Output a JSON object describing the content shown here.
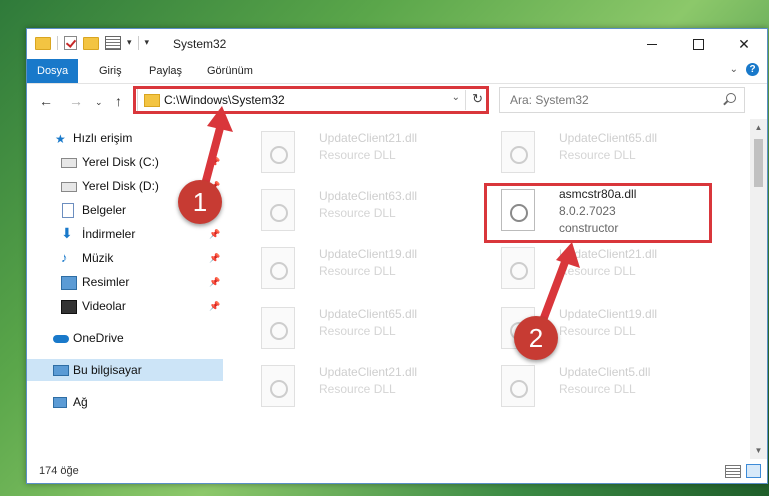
{
  "window": {
    "title": "System32"
  },
  "ribbon": {
    "tabs": [
      "Dosya",
      "Giriş",
      "Paylaş",
      "Görünüm"
    ],
    "active_tab": "Dosya"
  },
  "nav": {
    "address": "C:\\Windows\\System32",
    "search_placeholder": "Ara: System32"
  },
  "sidebar": {
    "items": [
      {
        "label": "Hızlı erişim",
        "icon": "star-icon",
        "pinned": false
      },
      {
        "label": "Yerel Disk (C:)",
        "icon": "drive-icon",
        "pinned": true
      },
      {
        "label": "Yerel Disk (D:)",
        "icon": "drive-icon",
        "pinned": true
      },
      {
        "label": "Belgeler",
        "icon": "documents-icon",
        "pinned": true
      },
      {
        "label": "İndirmeler",
        "icon": "download-icon",
        "pinned": true
      },
      {
        "label": "Müzik",
        "icon": "music-icon",
        "pinned": true
      },
      {
        "label": "Resimler",
        "icon": "pictures-icon",
        "pinned": true
      },
      {
        "label": "Videolar",
        "icon": "video-icon",
        "pinned": true
      },
      {
        "label": "OneDrive",
        "icon": "cloud-icon",
        "pinned": false
      },
      {
        "label": "Bu bilgisayar",
        "icon": "computer-icon",
        "pinned": false
      },
      {
        "label": "Ağ",
        "icon": "network-icon",
        "pinned": false
      }
    ]
  },
  "files": [
    {
      "name": "UpdateClient21.dll",
      "desc": "Resource DLL"
    },
    {
      "name": "UpdateClient65.dll",
      "desc": "Resource DLL"
    },
    {
      "name": "UpdateClient63.dll",
      "desc": "Resource DLL"
    },
    {
      "name": "asmcstr80a.dll",
      "desc": "8.0.2.7023",
      "desc2": "constructor",
      "highlighted": true
    },
    {
      "name": "UpdateClient19.dll",
      "desc": "Resource DLL"
    },
    {
      "name": "UpdateClient21.dll",
      "desc": "Resource DLL"
    },
    {
      "name": "UpdateClient65.dll",
      "desc": "Resource DLL"
    },
    {
      "name": "UpdateClient19.dll",
      "desc": "Resource DLL"
    },
    {
      "name": "UpdateClient21.dll",
      "desc": "Resource DLL"
    },
    {
      "name": "UpdateClient5.dll",
      "desc": "Resource DLL"
    }
  ],
  "status": {
    "item_count": "174 öğe"
  },
  "callouts": {
    "one": "1",
    "two": "2"
  },
  "colors": {
    "accent": "#1979ca",
    "highlight": "#d9363b",
    "selected": "#cce4f7"
  }
}
